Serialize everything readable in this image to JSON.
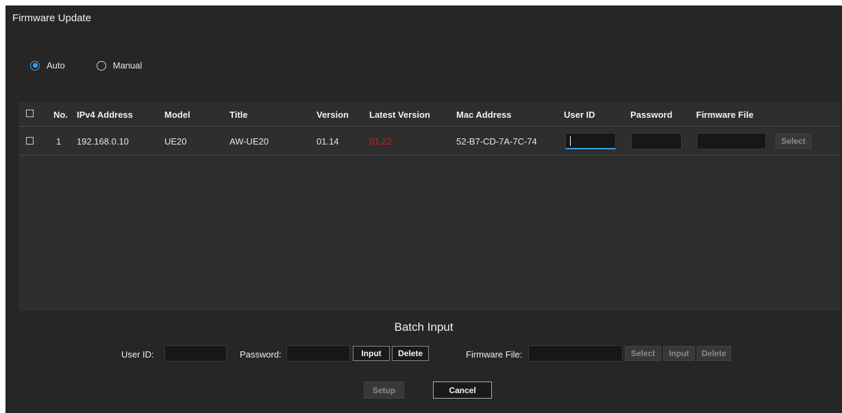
{
  "window": {
    "title": "Firmware Update"
  },
  "mode": {
    "options": [
      {
        "label": "Auto",
        "selected": true
      },
      {
        "label": "Manual",
        "selected": false
      }
    ]
  },
  "table": {
    "headers": {
      "no": "No.",
      "ipv4": "IPv4 Address",
      "model": "Model",
      "title": "Title",
      "version": "Version",
      "latest": "Latest Version",
      "mac": "Mac Address",
      "userid": "User ID",
      "password": "Password",
      "firmware": "Firmware File"
    },
    "rows": [
      {
        "no": "1",
        "ipv4": "192.168.0.10",
        "model": "UE20",
        "title": "AW-UE20",
        "version": "01.14",
        "latest": "01.22",
        "mac": "52-B7-CD-7A-7C-74",
        "userid": "",
        "password": "",
        "firmware": "",
        "select_label": "Select"
      }
    ]
  },
  "batch": {
    "title": "Batch Input",
    "userid_label": "User ID:",
    "password_label": "Password:",
    "input_label": "Input",
    "delete_label": "Delete",
    "firmware_label": "Firmware File:",
    "fw_select_label": "Select",
    "fw_input_label": "Input",
    "fw_delete_label": "Delete"
  },
  "footer": {
    "setup_label": "Setup",
    "cancel_label": "Cancel"
  },
  "colors": {
    "accent": "#3aa0e8",
    "latest_version_text": "#d02020",
    "background": "#262626"
  }
}
